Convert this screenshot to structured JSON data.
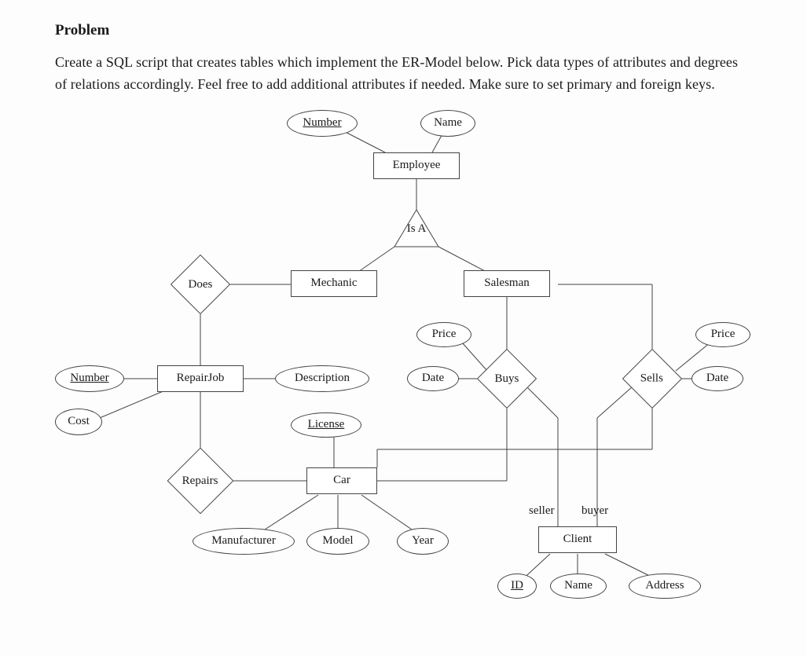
{
  "heading": "Problem",
  "body": "Create a SQL script that creates tables which implement the ER-Model below. Pick data types of attributes and degrees of relations accordingly. Feel free to add additional attributes if needed. Make sure to set primary and foreign keys.",
  "er": {
    "entities": {
      "employee": "Employee",
      "mechanic": "Mechanic",
      "salesman": "Salesman",
      "repairjob": "RepairJob",
      "car": "Car",
      "client": "Client"
    },
    "relationships": {
      "isa": "Is A",
      "does": "Does",
      "buys": "Buys",
      "sells": "Sells",
      "repairs": "Repairs"
    },
    "attributes": {
      "emp_number": "Number",
      "emp_name": "Name",
      "rj_number": "Number",
      "rj_cost": "Cost",
      "rj_description": "Description",
      "buys_price": "Price",
      "buys_date": "Date",
      "sells_price": "Price",
      "sells_date": "Date",
      "car_license": "License",
      "car_manufacturer": "Manufacturer",
      "car_model": "Model",
      "car_year": "Year",
      "client_id": "ID",
      "client_name": "Name",
      "client_address": "Address"
    },
    "roles": {
      "seller": "seller",
      "buyer": "buyer"
    }
  },
  "chart_data": {
    "type": "er-diagram",
    "entities": [
      {
        "name": "Employee",
        "attributes": [
          {
            "name": "Number",
            "key": true
          },
          {
            "name": "Name"
          }
        ]
      },
      {
        "name": "Mechanic",
        "isa": "Employee"
      },
      {
        "name": "Salesman",
        "isa": "Employee"
      },
      {
        "name": "RepairJob",
        "attributes": [
          {
            "name": "Number",
            "key": true
          },
          {
            "name": "Cost"
          },
          {
            "name": "Description"
          }
        ]
      },
      {
        "name": "Car",
        "attributes": [
          {
            "name": "License",
            "key": true
          },
          {
            "name": "Manufacturer"
          },
          {
            "name": "Model"
          },
          {
            "name": "Year"
          }
        ]
      },
      {
        "name": "Client",
        "attributes": [
          {
            "name": "ID",
            "key": true
          },
          {
            "name": "Name"
          },
          {
            "name": "Address"
          }
        ]
      }
    ],
    "relationships": [
      {
        "name": "Does",
        "between": [
          "Mechanic",
          "RepairJob"
        ]
      },
      {
        "name": "Repairs",
        "between": [
          "RepairJob",
          "Car"
        ]
      },
      {
        "name": "Buys",
        "between": [
          "Salesman",
          "Car",
          "Client"
        ],
        "attributes": [
          "Price",
          "Date"
        ],
        "client_role": "seller"
      },
      {
        "name": "Sells",
        "between": [
          "Salesman",
          "Car",
          "Client"
        ],
        "attributes": [
          "Price",
          "Date"
        ],
        "client_role": "buyer"
      }
    ]
  }
}
